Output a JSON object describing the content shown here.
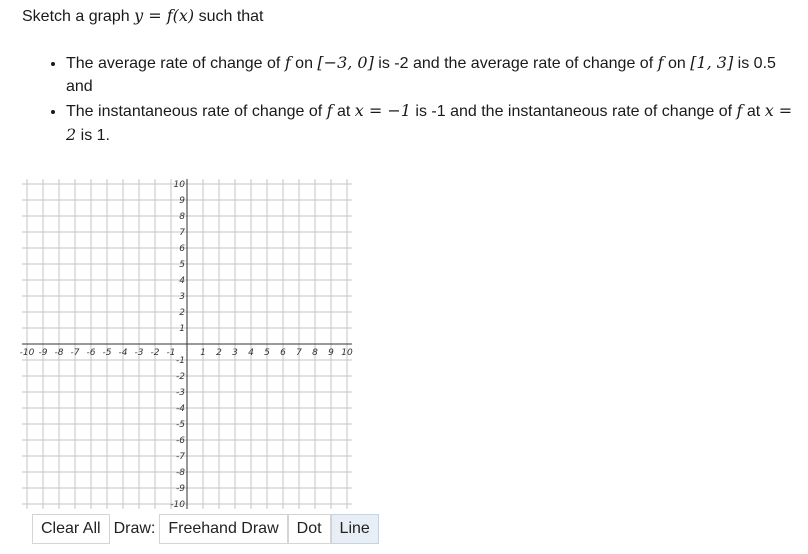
{
  "question": {
    "intro_before": "Sketch a graph ",
    "intro_math": "y = f(x)",
    "intro_after": " such that",
    "bullets": [
      {
        "p1": "The average rate of change of ",
        "m1": "f",
        "p2": " on ",
        "m2": "[−3, 0]",
        "p3": " is -2 and the average rate of change of ",
        "m3": "f",
        "p4": " on ",
        "m4": "[1, 3]",
        "p5": " is 0.5 and"
      },
      {
        "p1": "The instantaneous rate of change of ",
        "m1": "f",
        "p2": " at ",
        "m2": "x = −1",
        "p3": " is -1 and the instantaneous rate of change of ",
        "m3": "f",
        "p4": " at ",
        "m4": "x = 2",
        "p5": " is 1."
      }
    ]
  },
  "graph": {
    "x_min": -10,
    "x_max": 10,
    "y_min": -10,
    "y_max": 10,
    "grid": true,
    "x_ticks": [
      "-10",
      "-9",
      "-8",
      "-7",
      "-6",
      "-5",
      "-4",
      "-3",
      "-2",
      "-1",
      "1",
      "2",
      "3",
      "4",
      "5",
      "6",
      "7",
      "8",
      "9",
      "10"
    ],
    "y_ticks": [
      "10",
      "9",
      "8",
      "7",
      "6",
      "5",
      "4",
      "3",
      "2",
      "1",
      "-1",
      "-2",
      "-3",
      "-4",
      "-5",
      "-6",
      "-7",
      "-8",
      "-9",
      "-10"
    ]
  },
  "toolbar": {
    "clear_all": "Clear All",
    "draw_label": "Draw:",
    "freehand": "Freehand Draw",
    "dot": "Dot",
    "line": "Line",
    "active_tool": "line"
  }
}
